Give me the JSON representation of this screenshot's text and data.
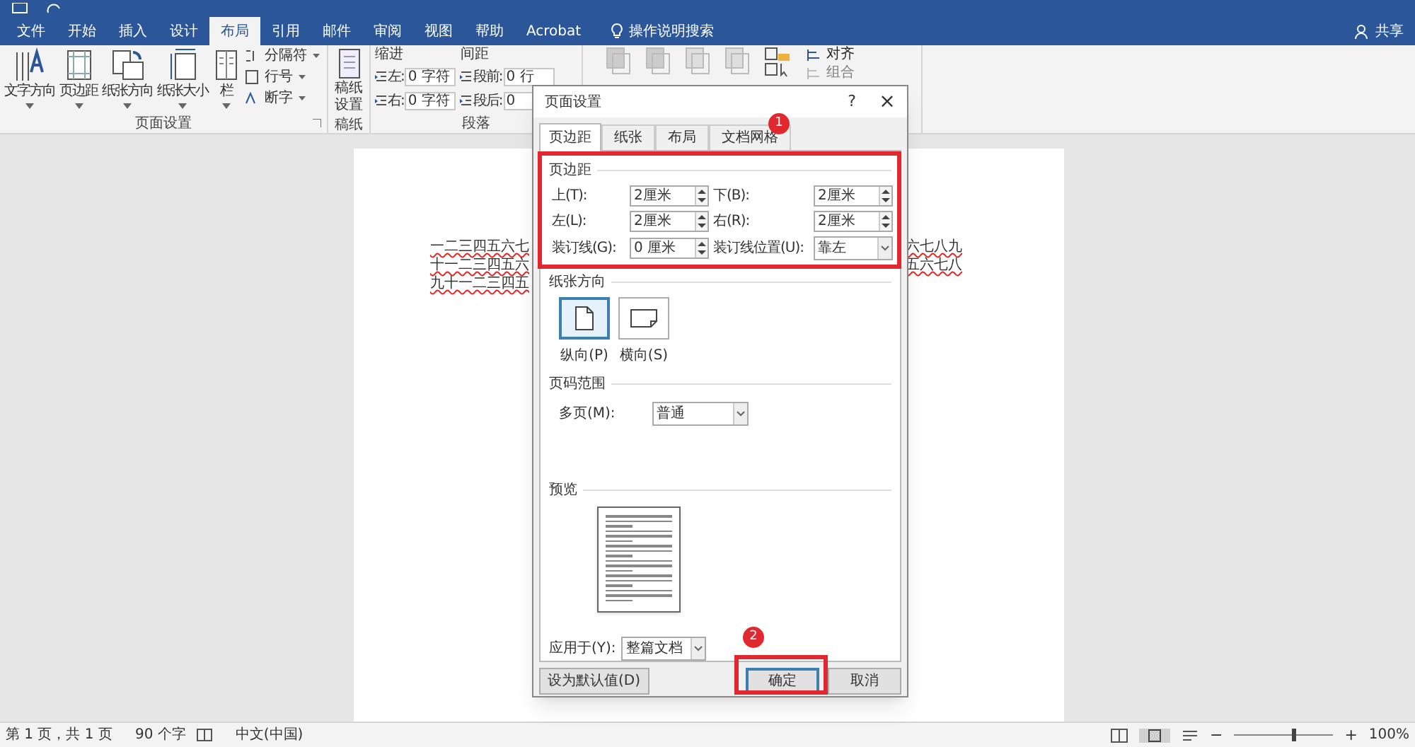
{
  "ribbon_tabs": [
    {
      "label": "文件",
      "selected": false
    },
    {
      "label": "开始",
      "selected": false
    },
    {
      "label": "插入",
      "selected": false
    },
    {
      "label": "设计",
      "selected": false
    },
    {
      "label": "布局",
      "selected": true
    },
    {
      "label": "引用",
      "selected": false
    },
    {
      "label": "邮件",
      "selected": false
    },
    {
      "label": "审阅",
      "selected": false
    },
    {
      "label": "视图",
      "selected": false
    },
    {
      "label": "帮助",
      "selected": false
    },
    {
      "label": "Acrobat",
      "selected": false
    }
  ],
  "tell_me": "操作说明搜索",
  "share": "共享",
  "groups": {
    "page_setup": {
      "large_buttons": [
        "文字方向",
        "页边距",
        "纸张方向",
        "纸张大小",
        "栏"
      ],
      "small_buttons": [
        "分隔符",
        "行号",
        "断字"
      ],
      "label": "页面设置"
    },
    "draft": {
      "button": "稿纸设置",
      "label": "稿纸"
    },
    "paragraph": {
      "indent_label": "缩进",
      "indent": [
        {
          "label": "左:",
          "value": "0 字符"
        },
        {
          "label": "右:",
          "value": "0 字符"
        }
      ],
      "spacing_label": "间距",
      "spacing": [
        {
          "label": "段前:",
          "value": "0 行"
        },
        {
          "label": "段后:",
          "value": "0"
        }
      ],
      "label": "段落"
    },
    "arrange": {
      "items": [
        {
          "label": "对齐",
          "disabled": false
        },
        {
          "label": "组合",
          "disabled": true
        }
      ]
    }
  },
  "document": {
    "left_fragments": [
      "一二三四五六七",
      "十一二三四五六",
      "九十一二三四五"
    ],
    "right_fragments": [
      "六七八九",
      "五六七八"
    ]
  },
  "dialog": {
    "title": "页面设置",
    "help": "?",
    "close": "×",
    "tabs": [
      {
        "label": "页边距",
        "selected": true
      },
      {
        "label": "纸张",
        "selected": false
      },
      {
        "label": "布局",
        "selected": false
      },
      {
        "label": "文档网格",
        "selected": false
      }
    ],
    "margins_label": "页边距",
    "margins": [
      {
        "label": "上(T):",
        "value": "2厘米",
        "kind": "spin"
      },
      {
        "label": "下(B):",
        "value": "2厘米",
        "kind": "spin"
      },
      {
        "label": "左(L):",
        "value": "2厘米",
        "kind": "spin"
      },
      {
        "label": "右(R):",
        "value": "2厘米",
        "kind": "spin"
      },
      {
        "label": "装订线(G):",
        "value": "0 厘米",
        "kind": "spin"
      },
      {
        "label": "装订线位置(U):",
        "value": "靠左",
        "kind": "select"
      }
    ],
    "orientation_label": "纸张方向",
    "orientations": [
      {
        "label": "纵向(P)",
        "selected": true
      },
      {
        "label": "横向(S)",
        "selected": false
      }
    ],
    "pages_label": "页码范围",
    "multiple_pages": {
      "label": "多页(M):",
      "value": "普通"
    },
    "preview_label": "预览",
    "apply_to": {
      "label": "应用于(Y):",
      "value": "整篇文档"
    },
    "buttons": [
      {
        "label": "设为默认值(D)",
        "default": false
      },
      {
        "label": "确定",
        "default": true
      },
      {
        "label": "取消",
        "default": false
      }
    ]
  },
  "annotations": [
    {
      "number": "1"
    },
    {
      "number": "2"
    }
  ],
  "status_bar": {
    "page": "第 1 页，共 1 页",
    "words": "90 个字",
    "language": "中文(中国)",
    "zoom": {
      "level": 0.6
    },
    "zoom_text": "100%",
    "zoom_out": "−",
    "zoom_in": "+"
  }
}
